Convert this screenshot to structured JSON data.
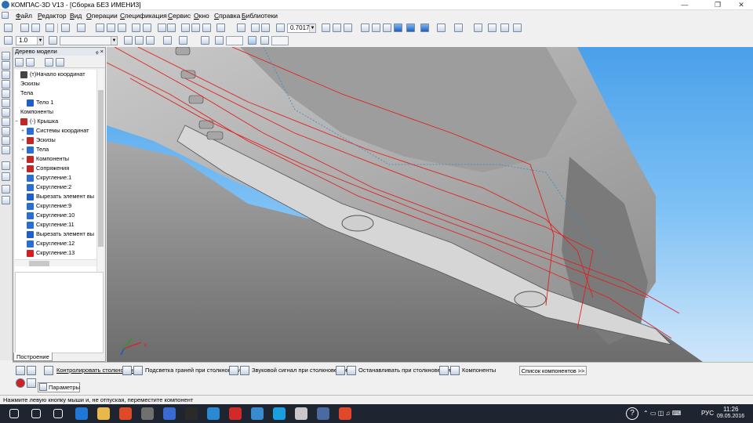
{
  "window": {
    "title": "КОМПАС-3D V13 - [Сборка БЕЗ ИМЕНИ3]",
    "controls": [
      "—",
      "❐",
      "✕"
    ]
  },
  "menu": [
    "Файл",
    "Редактор",
    "Вид",
    "Операции",
    "Спецификация",
    "Сервис",
    "Окно",
    "Справка",
    "Библиотеки"
  ],
  "toolbar": {
    "zoom_value": "0.7017",
    "step_value": "1.0"
  },
  "tree": {
    "header": "Дерево модели",
    "header_controls": "ᵩ ×",
    "items": [
      {
        "label": "(т)Начало координат",
        "indent": 0,
        "expander": "",
        "icon": "origin-icon",
        "color": "#444"
      },
      {
        "label": "Эскизы",
        "indent": 0,
        "expander": "",
        "icon": "",
        "color": ""
      },
      {
        "label": "Тела",
        "indent": 0,
        "expander": "",
        "icon": "",
        "color": ""
      },
      {
        "label": "Тело 1",
        "indent": 1,
        "expander": "",
        "icon": "body-icon",
        "color": "#1d5fc6"
      },
      {
        "label": "Компоненты",
        "indent": 0,
        "expander": "",
        "icon": "",
        "color": ""
      },
      {
        "label": "(-) Крышка",
        "indent": 0,
        "expander": "−",
        "icon": "part-icon",
        "color": "#c02828"
      },
      {
        "label": "Системы координат",
        "indent": 1,
        "expander": "+",
        "icon": "coord-system-icon",
        "color": "#2a6fd0"
      },
      {
        "label": "Эскизы",
        "indent": 1,
        "expander": "+",
        "icon": "sketch-icon",
        "color": "#c02828"
      },
      {
        "label": "Тела",
        "indent": 1,
        "expander": "+",
        "icon": "bodies-icon",
        "color": "#2a6fd0"
      },
      {
        "label": "Компоненты",
        "indent": 1,
        "expander": "+",
        "icon": "components-icon",
        "color": "#c02828"
      },
      {
        "label": "Сопряжения",
        "indent": 1,
        "expander": "+",
        "icon": "mate-icon",
        "color": "#c02828"
      },
      {
        "label": "Скругление:1",
        "indent": 1,
        "expander": "",
        "icon": "fillet-icon",
        "color": "#2a6fd0"
      },
      {
        "label": "Скругление:2",
        "indent": 1,
        "expander": "",
        "icon": "fillet-icon",
        "color": "#2a6fd0"
      },
      {
        "label": "Вырезать элемент вы",
        "indent": 1,
        "expander": "",
        "icon": "cut-extrude-icon",
        "color": "#1d5fc6"
      },
      {
        "label": "Скругление:9",
        "indent": 1,
        "expander": "",
        "icon": "fillet-icon",
        "color": "#2a6fd0"
      },
      {
        "label": "Скругление:10",
        "indent": 1,
        "expander": "",
        "icon": "fillet-icon",
        "color": "#2a6fd0"
      },
      {
        "label": "Скругление:11",
        "indent": 1,
        "expander": "",
        "icon": "fillet-icon",
        "color": "#2a6fd0"
      },
      {
        "label": "Вырезать элемент вы",
        "indent": 1,
        "expander": "",
        "icon": "cut-extrude-icon",
        "color": "#1d5fc6"
      },
      {
        "label": "Скругление:12",
        "indent": 1,
        "expander": "",
        "icon": "fillet-icon",
        "color": "#2a6fd0"
      },
      {
        "label": "Скругление:13",
        "indent": 1,
        "expander": "",
        "icon": "fillet-icon",
        "color": "#d02020"
      }
    ],
    "tab": "Построение"
  },
  "properties": {
    "items": [
      {
        "label": "Контролировать столкновения",
        "icon": "collision-control-icon",
        "underline": true
      },
      {
        "label": "Подсветка граней при столкновении",
        "icon": "highlight-faces-icon",
        "underline": false
      },
      {
        "label": "Звуковой сигнал при столкновении",
        "icon": "sound-signal-icon",
        "underline": false
      },
      {
        "label": "Останавливать при столкновении",
        "icon": "stop-on-collision-icon",
        "underline": false
      },
      {
        "label": "Компоненты",
        "icon": "components-filter-icon",
        "underline": false
      }
    ],
    "list_button": "Список компонентов   >>",
    "tab": "Параметры"
  },
  "status": "Нажмите левую кнопку мыши и, не отпуская, переместите компонент",
  "taskbar": {
    "lang": "РУС",
    "time": "11:26",
    "date": "09.05.2016",
    "apps": [
      "windows-start-icon",
      "search-icon",
      "task-view-icon",
      "edge-icon",
      "explorer-icon",
      "chrome-icon",
      "calc-icon",
      "store-icon",
      "cf-icon",
      "photos-icon",
      "opera-icon",
      "mail-icon",
      "skype-icon",
      "media-icon",
      "kompas-icon",
      "chrome2-icon"
    ]
  },
  "viewport": {
    "triad_label_x": "X",
    "colors": {
      "sky_top": "#4aa0ea",
      "model_gray": "#b8b8b8",
      "edge_red": "#e02020"
    }
  }
}
